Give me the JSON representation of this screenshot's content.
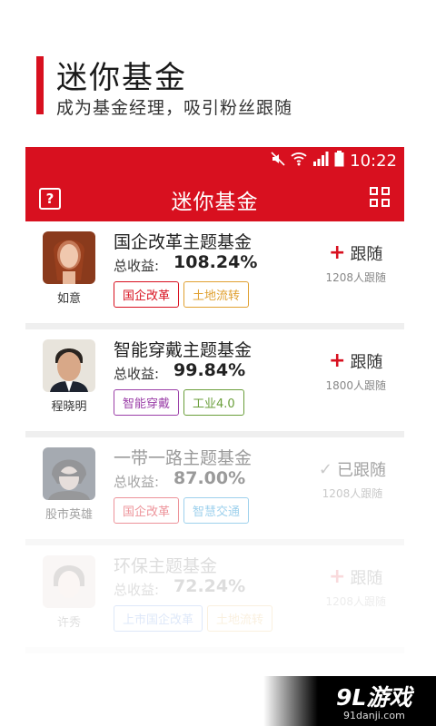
{
  "promo": {
    "title": "迷你基金",
    "subtitle": "成为基金经理，吸引粉丝跟随"
  },
  "status_bar": {
    "time": "10:22",
    "icons": [
      "mute-icon",
      "wifi-icon",
      "signal-icon",
      "battery-icon"
    ]
  },
  "nav": {
    "title": "迷你基金",
    "help_icon": "question-icon",
    "help_label": "?",
    "menu_icon": "grid-menu-icon"
  },
  "funds": [
    {
      "manager": "如意",
      "name": "国企改革主题基金",
      "return_label": "总收益:",
      "return_value": "108.24%",
      "tags": [
        {
          "label": "国企改革",
          "color": "#d8101f"
        },
        {
          "label": "土地流转",
          "color": "#e0a030"
        }
      ],
      "follow_label": "跟随",
      "followed": false,
      "follow_count": "1208人跟随"
    },
    {
      "manager": "程晓明",
      "name": "智能穿戴主题基金",
      "return_label": "总收益:",
      "return_value": "99.84%",
      "tags": [
        {
          "label": "智能穿戴",
          "color": "#9b3fa8"
        },
        {
          "label": "工业4.0",
          "color": "#6a9e3a"
        }
      ],
      "follow_label": "跟随",
      "followed": false,
      "follow_count": "1800人跟随"
    },
    {
      "manager": "股市英雄",
      "name": "一带一路主题基金",
      "return_label": "总收益:",
      "return_value": "87.00%",
      "tags": [
        {
          "label": "国企改革",
          "color": "#d8101f"
        },
        {
          "label": "智慧交通",
          "color": "#2a9ad8"
        }
      ],
      "follow_label": "已跟随",
      "followed": true,
      "follow_count": "1208人跟随"
    },
    {
      "manager": "许秀",
      "name": "环保主题基金",
      "return_label": "总收益:",
      "return_value": "72.24%",
      "tags": [
        {
          "label": "上市国企改革",
          "color": "#2a6ad8"
        },
        {
          "label": "土地流转",
          "color": "#e0a030"
        }
      ],
      "follow_label": "跟随",
      "followed": false,
      "follow_count": "1208人跟随"
    }
  ],
  "watermark": {
    "main": "9L游戏",
    "sub": "91danji.com"
  },
  "colors": {
    "brand_red": "#d8101f",
    "divider": "#efefef"
  }
}
